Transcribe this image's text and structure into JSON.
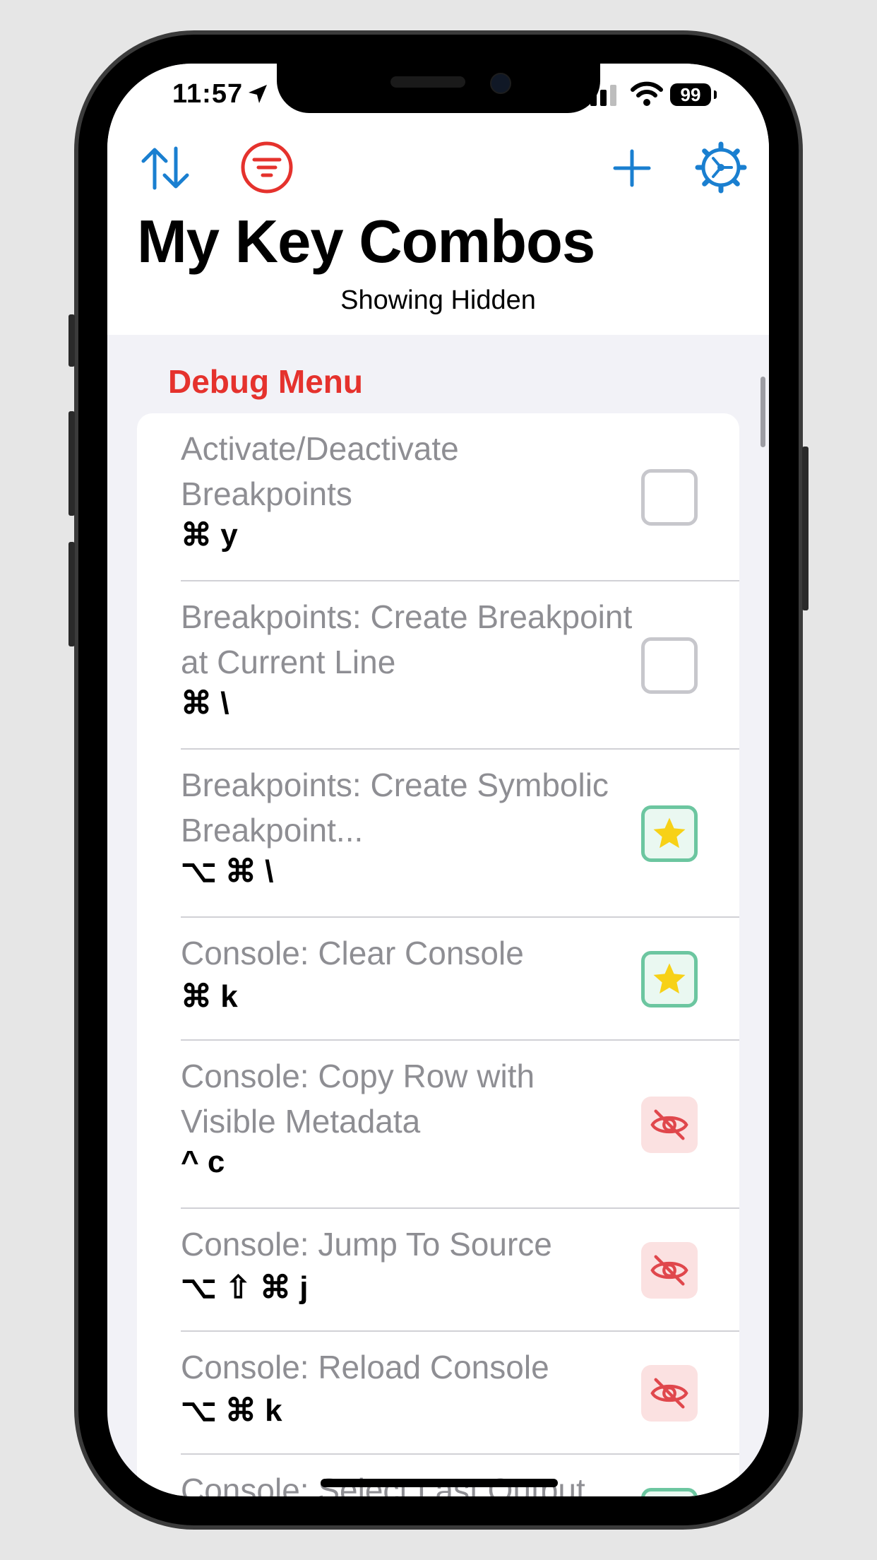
{
  "status_bar": {
    "time": "11:57",
    "battery": "99",
    "location_icon": "location-arrow-icon",
    "signal_icon": "cellular-signal-icon",
    "wifi_icon": "wifi-icon"
  },
  "toolbar": {
    "sort_icon": "sort-arrows-icon",
    "filter_icon": "filter-icon",
    "add_icon": "plus-icon",
    "settings_icon": "gear-icon",
    "accent": "#1a7fd0",
    "filter_color": "#e5322d"
  },
  "header": {
    "title": "My Key Combos",
    "subtitle": "Showing Hidden"
  },
  "section": {
    "title": "Debug Menu",
    "color": "#e5322d"
  },
  "rows": [
    {
      "name": "Activate/Deactivate Breakpoints",
      "keys": "⌘ y",
      "state": "unchecked"
    },
    {
      "name": "Breakpoints: Create Breakpoint at Current Line",
      "keys": "⌘ \\",
      "state": "unchecked"
    },
    {
      "name": "Breakpoints: Create Symbolic Breakpoint...",
      "keys": "⌥ ⌘ \\",
      "state": "favorite"
    },
    {
      "name": "Console: Clear Console",
      "keys": "⌘ k",
      "state": "favorite"
    },
    {
      "name": "Console: Copy Row with Visible Metadata",
      "keys": "^ c",
      "state": "hidden"
    },
    {
      "name": "Console: Jump To Source",
      "keys": "⌥ ⇧ ⌘ j",
      "state": "hidden"
    },
    {
      "name": "Console: Reload Console",
      "keys": "⌥ ⌘ k",
      "state": "hidden"
    },
    {
      "name": "Console: Select Last Output",
      "keys": "",
      "state": "favorite"
    }
  ]
}
